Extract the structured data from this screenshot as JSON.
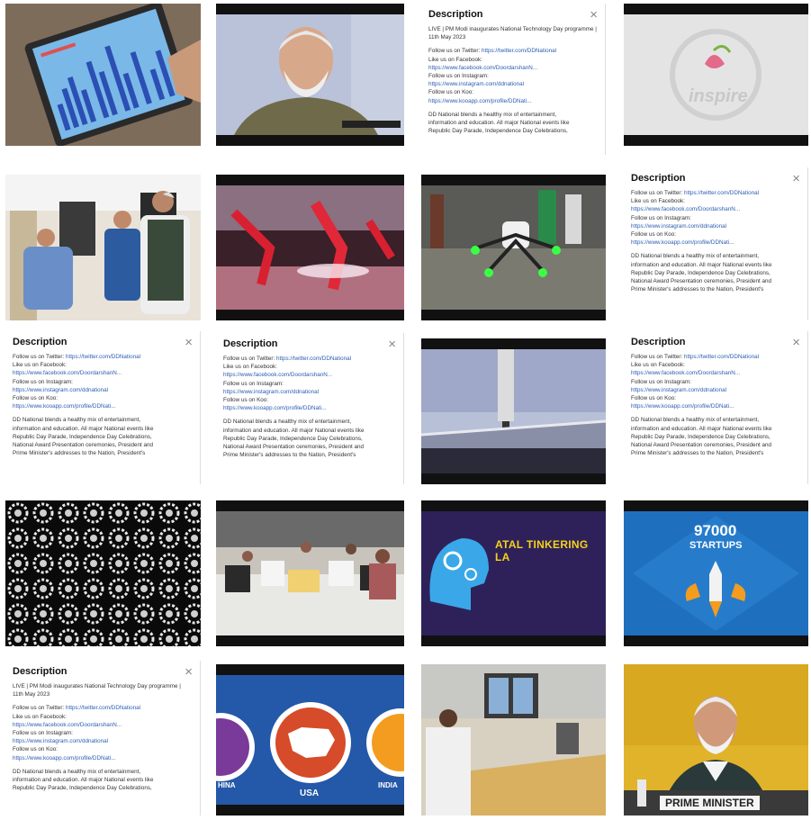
{
  "colors": {
    "link": "#2a5db0",
    "atal_yellow": "#f6d21a",
    "startup_bg": "#1f6fbf",
    "map_bg": "#2458a8",
    "usa_red": "#d64b2a",
    "india_orange": "#f39c1f"
  },
  "description_panel": {
    "title": "Description",
    "close_icon": "close-icon",
    "live_title": "LIVE | PM Modi inaugurates National Technology Day programme | 11th May 2023",
    "follow_twitter_label": "Follow us on Twitter:",
    "twitter_url": "https://twitter.com/DDNational",
    "facebook_label": "Like us on Facebook:",
    "facebook_url": "https://www.facebook.com/DoordarshanN...",
    "instagram_label": "Follow us on Instagram:",
    "instagram_url": "https://www.instagram.com/ddnational",
    "koo_label": "Follow us on Koo:",
    "koo_url": "https://www.kooapp.com/profile/DDNati...",
    "about_1": "DD National blends a healthy mix of entertainment,",
    "about_2": "information and education. All major National events like",
    "about_3": "Republic Day Parade, Independence Day Celebrations,",
    "about_4": "National Award Presentation ceremonies, President and",
    "about_5": "Prime Minister's addresses to the Nation,  President's"
  },
  "thumbnails": {
    "inspire_logo_text": "inspire",
    "atal_caption": "ATAL TINKERING LA",
    "startups_number": "97000",
    "startups_word": "STARTUPS",
    "map_china": "HINA",
    "map_usa": "USA",
    "map_india": "INDIA",
    "pm_nameplate": "PRIME MINISTER"
  }
}
